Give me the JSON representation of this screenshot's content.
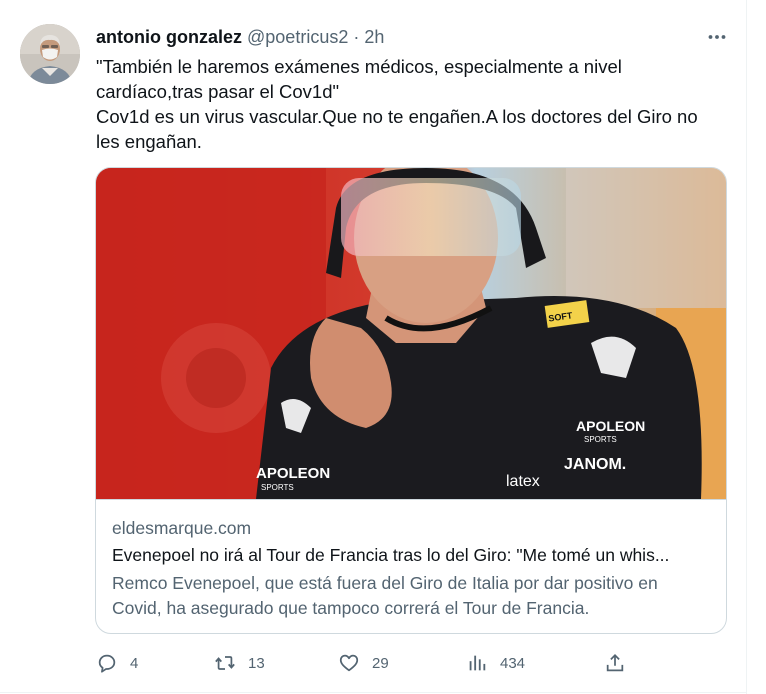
{
  "tweet": {
    "author_name": "antonio gonzalez",
    "author_handle": "@poetricus2",
    "separator": " · ",
    "time": "2h",
    "lines": [
      "\"También le haremos exámenes médicos, especialmente a nivel",
      "cardíaco,tras pasar el Cov1d\"",
      "Cov1d es un virus vascular.Que no te engañen.A los doctores del Giro no",
      "les engañan."
    ]
  },
  "card": {
    "domain": "eldesmarque.com",
    "title": "Evenepoel no irá al Tour de Francia tras lo del Giro: \"Me tomé un whis...",
    "description_lines": [
      "Remco Evenepoel, que está fuera del Giro de Italia por dar positivo en",
      "Covid, ha asegurado que tampoco correrá el Tour de Francia."
    ],
    "image_texts": {
      "brand_left": "APOLEON",
      "brand_left_sub": "SPORTS",
      "brand_right": "APOLEON",
      "brand_right_sub": "SPORTS",
      "latex": "latex",
      "sponsor": "JANOM.",
      "sleeve": "SOFT"
    }
  },
  "actions": {
    "replies": "4",
    "retweets": "13",
    "likes": "29",
    "views": "434"
  },
  "icons": {
    "more": "more-horizontal-icon",
    "reply": "reply-icon",
    "retweet": "retweet-icon",
    "like": "heart-icon",
    "views": "analytics-icon",
    "share": "share-icon"
  },
  "colors": {
    "text": "#0f1419",
    "secondary": "#536471",
    "border": "#cfd9de"
  }
}
